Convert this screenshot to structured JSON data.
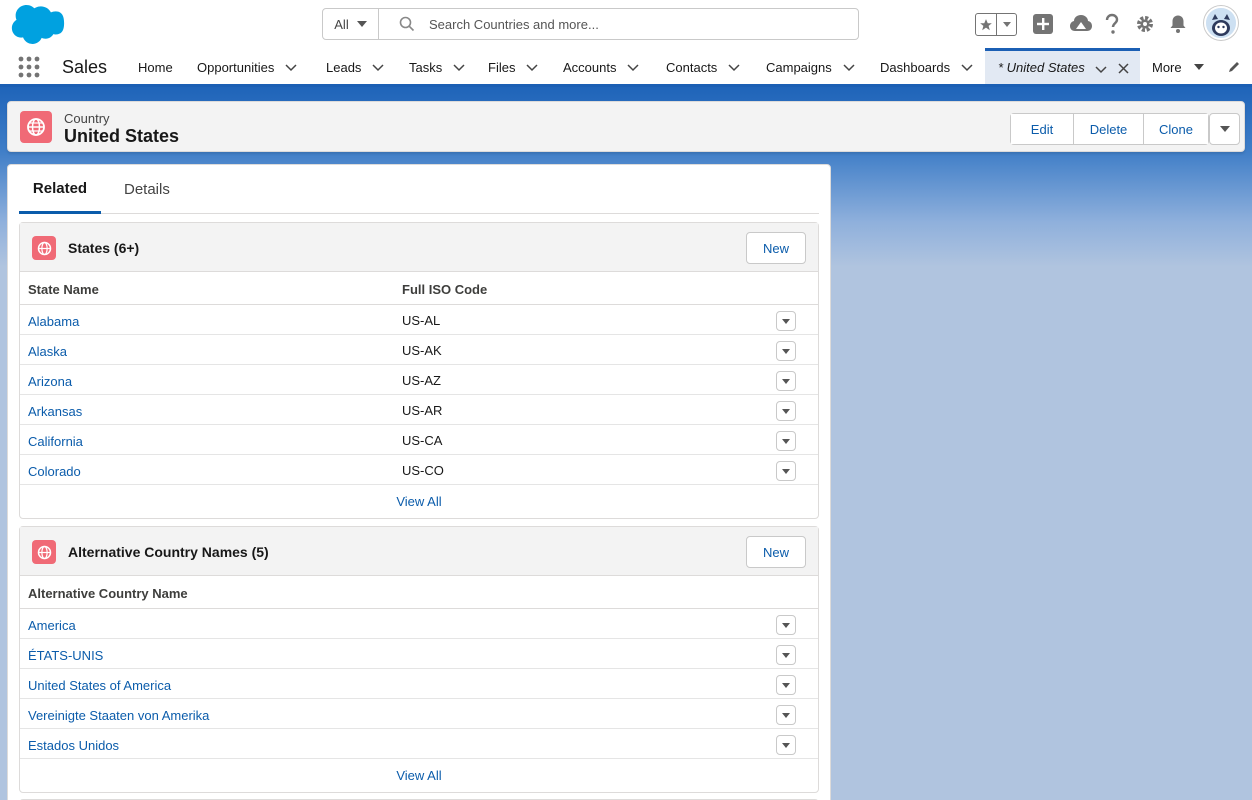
{
  "header": {
    "search_scope": "All",
    "search_placeholder": "Search Countries and more..."
  },
  "nav": {
    "app_name": "Sales",
    "items": [
      {
        "label": "Home",
        "has_menu": false
      },
      {
        "label": "Opportunities",
        "has_menu": true
      },
      {
        "label": "Leads",
        "has_menu": true
      },
      {
        "label": "Tasks",
        "has_menu": true
      },
      {
        "label": "Files",
        "has_menu": true
      },
      {
        "label": "Accounts",
        "has_menu": true
      },
      {
        "label": "Contacts",
        "has_menu": true
      },
      {
        "label": "Campaigns",
        "has_menu": true
      },
      {
        "label": "Dashboards",
        "has_menu": true
      }
    ],
    "active_tab": "* United States",
    "more": "More"
  },
  "record": {
    "type": "Country",
    "title": "United States",
    "actions": [
      "Edit",
      "Delete",
      "Clone"
    ]
  },
  "tabs": [
    "Related",
    "Details"
  ],
  "states_list": {
    "title": "States (6+)",
    "new_label": "New",
    "columns": [
      "State Name",
      "Full ISO Code"
    ],
    "rows": [
      {
        "name": "Alabama",
        "code": "US-AL"
      },
      {
        "name": "Alaska",
        "code": "US-AK"
      },
      {
        "name": "Arizona",
        "code": "US-AZ"
      },
      {
        "name": "Arkansas",
        "code": "US-AR"
      },
      {
        "name": "California",
        "code": "US-CA"
      },
      {
        "name": "Colorado",
        "code": "US-CO"
      }
    ],
    "view_all": "View All"
  },
  "alt_names_list": {
    "title": "Alternative Country Names (5)",
    "new_label": "New",
    "columns": [
      "Alternative Country Name"
    ],
    "rows": [
      {
        "name": "America"
      },
      {
        "name": "ÉTATS-UNIS"
      },
      {
        "name": "United States of America"
      },
      {
        "name": "Vereinigte Staaten von Amerika"
      },
      {
        "name": "Estados Unidos"
      }
    ],
    "view_all": "View All"
  },
  "colors": {
    "brand_blue": "#0b5cab",
    "country_icon": "#f06a76",
    "nav_accent": "#1b5fb4"
  }
}
